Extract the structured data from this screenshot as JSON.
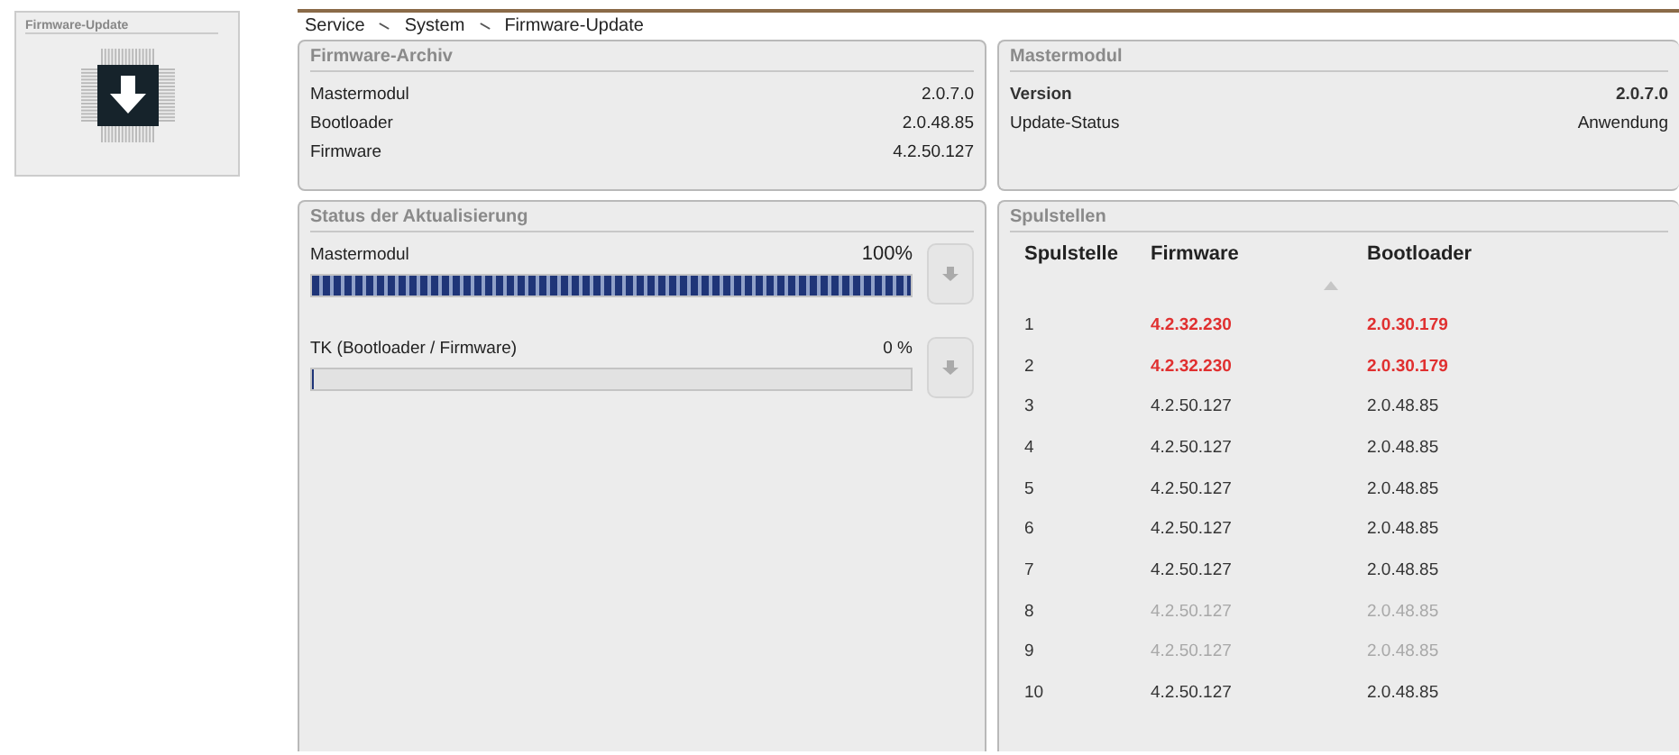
{
  "tile": {
    "title": "Firmware-Update"
  },
  "breadcrumb": [
    "Service",
    "System",
    "Firmware-Update"
  ],
  "firmware_archive": {
    "title": "Firmware-Archiv",
    "rows": [
      {
        "label": "Mastermodul",
        "value": "2.0.7.0"
      },
      {
        "label": "Bootloader",
        "value": "2.0.48.85"
      },
      {
        "label": "Firmware",
        "value": "4.2.50.127"
      }
    ]
  },
  "master_module": {
    "title": "Mastermodul",
    "rows": [
      {
        "label": "Version",
        "value": "2.0.7.0"
      },
      {
        "label": "Update-Status",
        "value": "Anwendung"
      }
    ]
  },
  "update_status": {
    "title": "Status der Aktualisierung",
    "items": [
      {
        "label": "Mastermodul",
        "reading": "100%",
        "level": 1
      },
      {
        "label": "TK (Bootloader / Firmware)",
        "reading": "0 %",
        "level": 0
      }
    ]
  },
  "spindles": {
    "title": "Spulstellen",
    "columns": [
      "Spulstelle",
      "Firmware",
      "Bootloader"
    ],
    "rows": [
      {
        "cells": [
          "1",
          "4.2.32.230",
          "2.0.30.179"
        ],
        "outdated": true,
        "disabled": false
      },
      {
        "cells": [
          "2",
          "4.2.32.230",
          "2.0.30.179"
        ],
        "outdated": true,
        "disabled": false
      },
      {
        "cells": [
          "3",
          "4.2.50.127",
          "2.0.48.85"
        ],
        "outdated": false,
        "disabled": false
      },
      {
        "cells": [
          "4",
          "4.2.50.127",
          "2.0.48.85"
        ],
        "outdated": false,
        "disabled": false
      },
      {
        "cells": [
          "5",
          "4.2.50.127",
          "2.0.48.85"
        ],
        "outdated": false,
        "disabled": false
      },
      {
        "cells": [
          "6",
          "4.2.50.127",
          "2.0.48.85"
        ],
        "outdated": false,
        "disabled": false
      },
      {
        "cells": [
          "7",
          "4.2.50.127",
          "2.0.48.85"
        ],
        "outdated": false,
        "disabled": false
      },
      {
        "cells": [
          "8",
          "4.2.50.127",
          "2.0.48.85"
        ],
        "outdated": false,
        "disabled": true
      },
      {
        "cells": [
          "9",
          "4.2.50.127",
          "2.0.48.85"
        ],
        "outdated": false,
        "disabled": true
      },
      {
        "cells": [
          "10",
          "4.2.50.127",
          "2.0.48.85"
        ],
        "outdated": false,
        "disabled": false
      }
    ]
  }
}
